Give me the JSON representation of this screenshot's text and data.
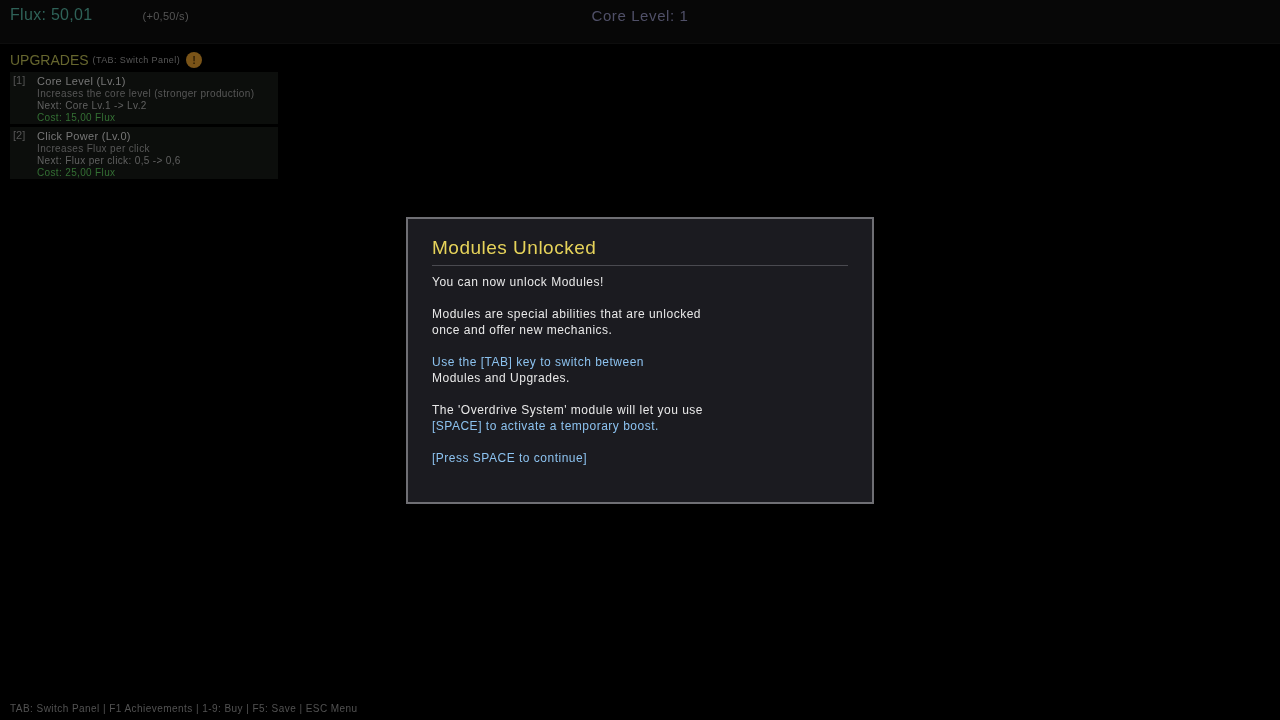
{
  "top_bar": {
    "flux": "Flux: 50,01",
    "rate": "(+0,50/s)",
    "core_level": "Core Level: 1"
  },
  "upgrades_panel": {
    "title": "UPGRADES",
    "hint": "(TAB: Switch Panel)",
    "badge": "!",
    "items": [
      {
        "key": "[1]",
        "name": "Core Level (Lv.1)",
        "description": "Increases the core level (stronger production)",
        "next": "Next: Core Lv.1 -> Lv.2",
        "cost": "Cost: 15,00 Flux"
      },
      {
        "key": "[2]",
        "name": "Click Power (Lv.0)",
        "description": "Increases Flux per click",
        "next": "Next: Flux per click: 0,5 -> 0,6",
        "cost": "Cost: 25,00 Flux"
      }
    ]
  },
  "dialog": {
    "title": "Modules Unlocked",
    "paragraphs": [
      {
        "lines": [
          {
            "text": "You can now unlock Modules!",
            "highlighted": false
          }
        ]
      },
      {
        "lines": [
          {
            "text": "Modules are special abilities that are unlocked",
            "highlighted": false
          },
          {
            "text": "once and offer new mechanics.",
            "highlighted": false
          }
        ]
      },
      {
        "lines": [
          {
            "text": "Use the [TAB] key to switch between",
            "highlighted": true
          },
          {
            "text": "Modules and Upgrades.",
            "highlighted": false
          }
        ]
      },
      {
        "lines": [
          {
            "text": "The 'Overdrive System' module will let you use",
            "highlighted": false
          },
          {
            "text": "[SPACE] to activate a temporary boost.",
            "highlighted": true
          }
        ]
      },
      {
        "lines": [
          {
            "text": "[Press SPACE to continue]",
            "highlighted": true
          }
        ]
      }
    ]
  },
  "footer": "TAB: Switch Panel | F1 Achievements | 1-9: Buy | F5: Save | ESC Menu"
}
